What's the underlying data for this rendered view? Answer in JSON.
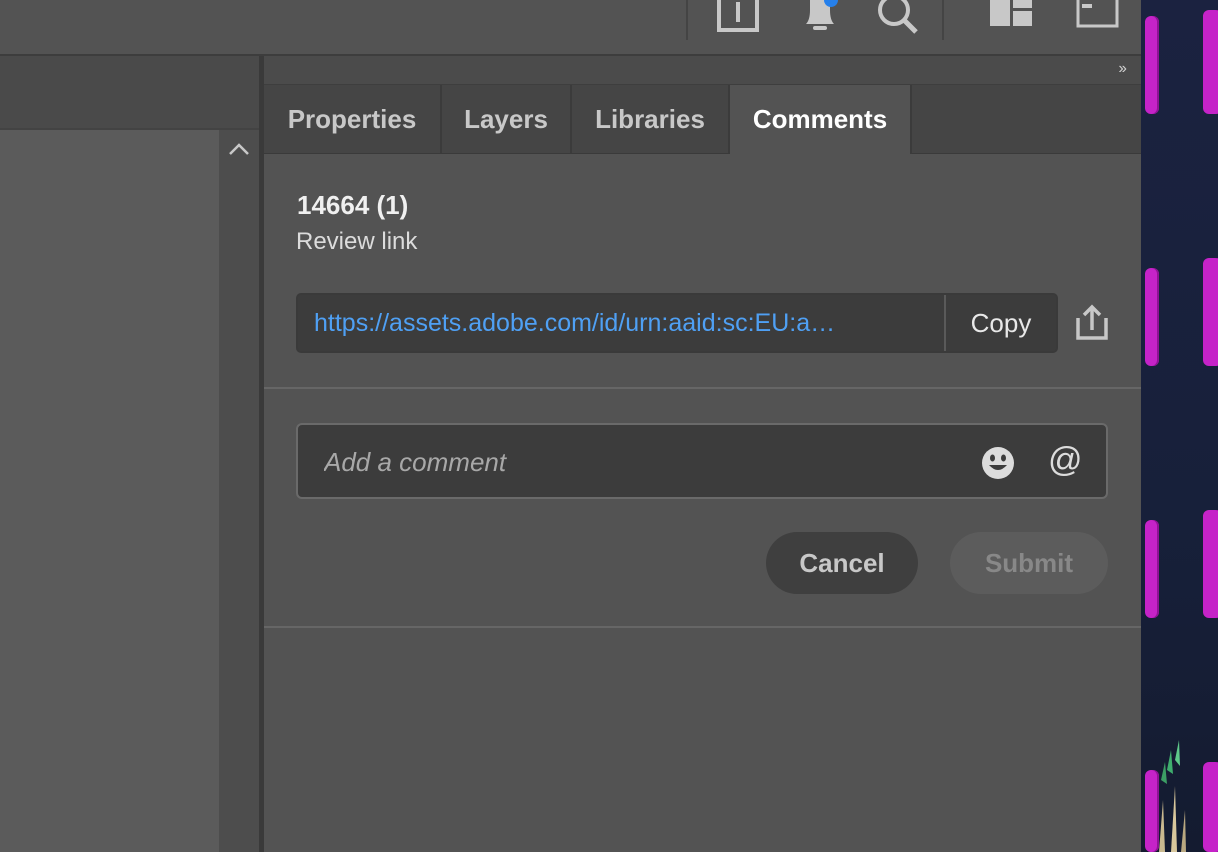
{
  "tabs": [
    {
      "label": "Properties"
    },
    {
      "label": "Layers"
    },
    {
      "label": "Libraries"
    },
    {
      "label": "Comments"
    }
  ],
  "active_tab": "Comments",
  "collapse_glyph": "››",
  "comments": {
    "title": "14664 (1)",
    "subtitle": "Review link",
    "review_link": "https://assets.adobe.com/id/urn:aaid:sc:EU:a…",
    "copy_label": "Copy",
    "comment_placeholder": "Add a comment",
    "at_symbol": "@",
    "cancel_label": "Cancel",
    "submit_label": "Submit"
  },
  "icons": {
    "toolbar": [
      "share-icon",
      "bell-icon",
      "search-icon",
      "panel-layout-icon",
      "sidebar-toggle-icon"
    ],
    "notification_dot_color": "#2680eb",
    "link_color": "#4fa0f4"
  }
}
